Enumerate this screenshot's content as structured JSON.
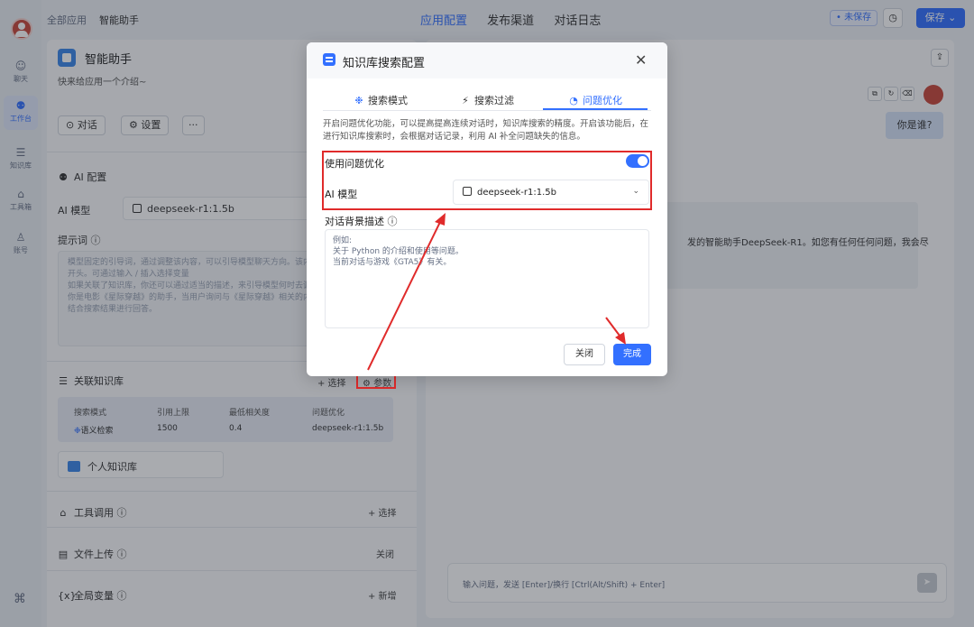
{
  "rail": {
    "items": [
      {
        "label": "聊天",
        "icon": "chat-icon"
      },
      {
        "label": "工作台",
        "icon": "robot-icon"
      },
      {
        "label": "知识库",
        "icon": "database-icon"
      },
      {
        "label": "工具箱",
        "icon": "toolbox-icon"
      },
      {
        "label": "账号",
        "icon": "user-icon"
      }
    ]
  },
  "topbar": {
    "crumb_root": "全部应用",
    "crumb_current": "智能助手",
    "tabs": [
      "应用配置",
      "发布渠道",
      "对话日志"
    ],
    "unsaved": "• 未保存",
    "save_label": "保存 ⌄"
  },
  "app": {
    "name": "智能助手",
    "intro": "快来给应用一个介绍~",
    "chat_btn": "⊙ 对话",
    "settings_btn": "⚙ 设置",
    "more_btn": "···"
  },
  "ai_config": {
    "title": "AI 配置",
    "model_label": "AI 模型",
    "model_value": "deepseek-r1:1.5b",
    "prompt_label": "提示词 ⓘ",
    "prompt_placeholder": "模型固定的引导词，通过调整该内容，可以引导模型聊天方向。该内容会被固定在上下文的开头。可通过输入 / 插入选择变量\n如果关联了知识库，你还可以通过适当的描述，来引导模型何时去调用知识库搜索。例如：\n你是电影《星际穿越》的助手，当用户询问与《星际穿越》相关的内容时，请搜索知识库并结合搜索结果进行回答。"
  },
  "kb": {
    "title": "关联知识库",
    "select": "+ 选择",
    "params": "⚙ 参数",
    "headers": [
      "搜索模式",
      "引用上限",
      "最低相关度",
      "问题优化"
    ],
    "values": [
      "语义检索",
      "1500",
      "0.4",
      "deepseek-r1:1.5b"
    ],
    "card": "个人知识库"
  },
  "sections": {
    "tools": "工具调用 ⓘ",
    "tools_action": "+ 选择",
    "upload": "文件上传 ⓘ",
    "upload_action": "关闭",
    "vars": "全局变量 ⓘ",
    "vars_action": "+ 新增"
  },
  "chat": {
    "user_msg": "你是谁?",
    "ai_msg": "发的智能助手DeepSeek-R1。如您有任何任何问题，我会尽",
    "input_placeholder": "输入问题，发送 [Enter]/换行 [Ctrl(Alt/Shift) + Enter]"
  },
  "modal": {
    "title": "知识库搜索配置",
    "tabs": [
      "搜索模式",
      "搜索过滤",
      "问题优化"
    ],
    "description": "开启问题优化功能，可以提高提高连续对话时，知识库搜索的精度。开启该功能后，在进行知识库搜索时，会根据对话记录，利用 AI 补全问题缺失的信息。",
    "use_label": "使用问题优化",
    "model_label": "AI 模型",
    "model_value": "deepseek-r1:1.5b",
    "bg_label": "对话背景描述 ⓘ",
    "bg_placeholder": "例如:\n关于 Python 的介绍和使用等问题。\n当前对话与游戏《GTA5》有关。",
    "cancel": "关闭",
    "confirm": "完成"
  }
}
